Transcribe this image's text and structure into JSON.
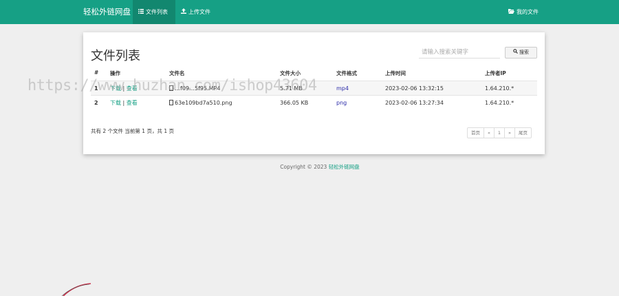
{
  "navbar": {
    "brand": "轻松外链网盘",
    "items": [
      {
        "label": "文件列表",
        "icon": "list-icon",
        "active": true
      },
      {
        "label": "上传文件",
        "icon": "upload-icon",
        "active": false
      }
    ],
    "right_item": {
      "label": "我的文件",
      "icon": "folder-open-icon"
    },
    "color": "#16a085"
  },
  "panel": {
    "title": "文件列表",
    "search": {
      "placeholder": "请输入搜索关键字",
      "button_label": "搜索"
    },
    "table": {
      "headers": [
        "#",
        "操作",
        "文件名",
        "文件大小",
        "文件格式",
        "上传时间",
        "上传者IP"
      ],
      "rows": [
        {
          "index": "1",
          "download": "下载",
          "view": "查看",
          "filename": "…f09…5f95.MP4",
          "size": "5.71 MB",
          "format": "mp4",
          "time": "2023-02-06 13:32:15",
          "ip": "1.64.210.*"
        },
        {
          "index": "2",
          "download": "下载",
          "view": "查看",
          "filename": "63e109bd7a510.png",
          "size": "366.05 KB",
          "format": "png",
          "time": "2023-02-06 13:27:34",
          "ip": "1.64.210.*"
        }
      ]
    },
    "summary": "共有 2 个文件  当前第 1 页，共 1 页",
    "pagination": {
      "first": "首页",
      "prev": "«",
      "current": "1",
      "next": "»",
      "last": "尾页"
    }
  },
  "footer": {
    "copyright": "Copyright © 2023 ",
    "brand_link": "轻松外链网盘"
  },
  "watermark": "https://www.huzhan.com/ishop43604"
}
